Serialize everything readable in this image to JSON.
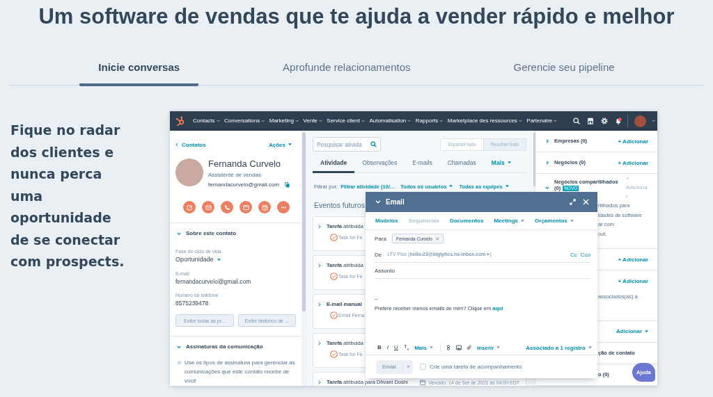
{
  "headline": "Um software de vendas que te ajuda a vender rápido e melhor",
  "tabs": [
    {
      "label": "Inicie conversas",
      "selected": true
    },
    {
      "label": "Aprofunde relacionamentos",
      "selected": false
    },
    {
      "label": "Gerencie seu pipeline",
      "selected": false
    }
  ],
  "intro": "Fique no radar dos clientes e nunca perca uma oportunidade de se conectar com prospects.",
  "app": {
    "nav": [
      "Contacts",
      "Conversations",
      "Marketing",
      "Vente",
      "Service client",
      "Automatisation",
      "Rapports",
      "Marketplace des ressources",
      "Partenaire"
    ],
    "contact": {
      "back_link": "Contatos",
      "actions_menu": "Ações",
      "name": "Fernanda Curvelo",
      "job_title": "Assistente de vendas",
      "email": "fernandacurvelo@gmail.com",
      "sections": [
        {
          "kind": "properties",
          "title": "Sobre este contato",
          "expanded": true,
          "fields": [
            {
              "label": "Fase do ciclo de vida",
              "value": "Oportunidade",
              "kind": "dropdown"
            },
            {
              "label": "E-mail",
              "value": "fernandacurvelo@gmail.com",
              "kind": "text"
            },
            {
              "label": "Número de telefone",
              "value": "8575239478",
              "kind": "text"
            }
          ],
          "buttons": [
            "Exibir todas as pr...",
            "Exibir histórico de ..."
          ]
        },
        {
          "kind": "note",
          "title": "Assinaturas da comunicação",
          "expanded": true,
          "note": "Use os tipos de assinatura para gerenciar as comunicações que este contato recebe de você"
        }
      ]
    },
    "activity": {
      "search": {
        "placeholder": "Pesquisar ativida"
      },
      "view_buttons": [
        {
          "label": "Expandir tudo",
          "selected": false
        },
        {
          "label": "Recolher tudo",
          "selected": true
        }
      ],
      "tabs": [
        {
          "label": "Atividade",
          "selected": true,
          "kind": "tab"
        },
        {
          "label": "Observações",
          "selected": false,
          "kind": "tab"
        },
        {
          "label": "E-mails",
          "selected": false,
          "kind": "tab"
        },
        {
          "label": "Chamadas",
          "selected": false,
          "kind": "tab"
        },
        {
          "label": "Mais",
          "selected": false,
          "kind": "menu"
        }
      ],
      "filter_label": "Filtrar por:",
      "filters": [
        {
          "label": "Filtrar atividade (19/...",
          "kind": "link"
        },
        {
          "label": "Todos os usuários",
          "kind": "dropdown"
        },
        {
          "label": "Todas as equipes",
          "kind": "dropdown"
        }
      ],
      "heading": "Eventos futuros",
      "events": [
        {
          "type": "Tarefa",
          "text": "atribuida",
          "detail": "Task for Fe"
        },
        {
          "type": "Tarefa",
          "text": "atribuida",
          "detail": "Task for Fe"
        },
        {
          "type": "E-mail manual",
          "detail": "Email Ferna"
        },
        {
          "type": "Tarefa",
          "text": "atribuida",
          "detail": "Task for Fe"
        },
        {
          "type": "Tarefa",
          "text": "atribuida para Dhvani Doshi",
          "due": "Vencido: 14 de Set de 2021 às 04:00 EDT"
        }
      ]
    },
    "associations": [
      {
        "title": "Empresas (0)",
        "expanded": false,
        "covered": false,
        "action": {
          "label": "+ Adicionar",
          "kind": "add",
          "disabled": false
        }
      },
      {
        "title": "Negócios (0)",
        "expanded": false,
        "covered": false,
        "action": {
          "label": "+ Adicionar",
          "kind": "add",
          "disabled": false
        }
      },
      {
        "title": "Negócios compartilhados",
        "count": "(0)",
        "badge": "NOVO",
        "expanded": true,
        "covered": false,
        "action": {
          "label": "+ Adicionar",
          "kind": "add",
          "disabled": true
        },
        "lines": [
          "rtilhados para",
          "idades de software",
          "ar com",
          "oot."
        ]
      },
      {
        "action": {
          "label": "+ Adicionar",
          "kind": "add",
          "disabled": false
        }
      },
      {
        "covered": true,
        "action": {
          "label": "+ Adicionar",
          "kind": "add",
          "disabled": false
        },
        "lines": [
          "associados(as) a"
        ]
      },
      {
        "action": {
          "label": "Adicionar",
          "kind": "dropdown",
          "disabled": false
        }
      },
      {
        "title": "ção de contato",
        "covered": true
      },
      {
        "title": "o (0)",
        "covered": true
      }
    ],
    "help_button": "Ajuda",
    "email": {
      "title": "Email",
      "tools": [
        {
          "label": "Modelos",
          "kind": "link",
          "disabled": false
        },
        {
          "label": "Sequências",
          "kind": "link",
          "disabled": true
        },
        {
          "label": "Documentos",
          "kind": "link",
          "disabled": false
        },
        {
          "label": "Meetings",
          "kind": "menu",
          "disabled": false
        },
        {
          "label": "Orçamentos",
          "kind": "menu",
          "disabled": false
        }
      ],
      "to_label": "Para",
      "recipient": "Fernanda Curvelo",
      "from_label": "De",
      "from": "LTV Plus (**hello-23@biglytics.hs-inbox.com** ▾)",
      "cc": "Cc",
      "bcc": "Cco",
      "subject": {
        "placeholder": "Assunto"
      },
      "signature": {
        "separator": "--",
        "text": "Prefere receber menos emails de mim? Clique em",
        "link": "aqui"
      },
      "format_buttons": [
        {
          "label": "B",
          "kind": "bold"
        },
        {
          "label": "I",
          "kind": "italic"
        },
        {
          "label": "U",
          "kind": "underline"
        },
        {
          "label": "T$_{x}$",
          "kind": "clear"
        }
      ],
      "format_menu": "Mais",
      "insert_menu": "Inserir",
      "association_menu": "Associado a 1 registro",
      "send": {
        "label": "Enviar",
        "disabled": true
      },
      "follow_up": {
        "label": "Crie uma tarefa de acompanhamento",
        "checked": false
      }
    }
  }
}
